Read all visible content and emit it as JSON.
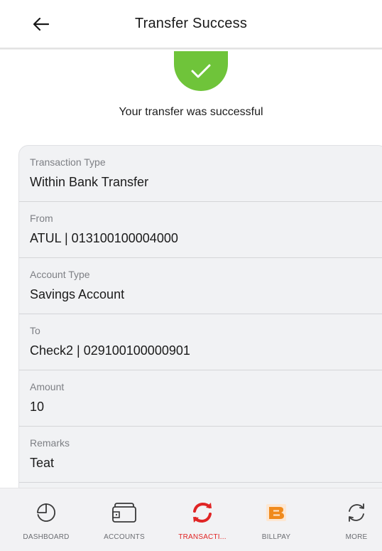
{
  "header": {
    "back_icon": "arrow-left-icon",
    "title": "Transfer Success"
  },
  "status": {
    "icon": "check-circle-icon",
    "color": "#6fc43a",
    "message": "Your transfer was successful"
  },
  "details": [
    {
      "label": "Transaction Type",
      "value": "Within Bank Transfer"
    },
    {
      "label": "From",
      "value": "ATUL | 013100100004000"
    },
    {
      "label": "Account Type",
      "value": "Savings Account"
    },
    {
      "label": "To",
      "value": "Check2 | 029100100000901"
    },
    {
      "label": "Amount",
      "value": "10"
    },
    {
      "label": "Remarks",
      "value": "Teat"
    }
  ],
  "bottom_nav": {
    "active_color": "#e02424",
    "items": [
      {
        "label": "DASHBOARD",
        "icon": "dashboard-icon"
      },
      {
        "label": "ACCOUNTS",
        "icon": "wallet-icon"
      },
      {
        "label": "TRANSACTI...",
        "icon": "transactions-icon",
        "active": true
      },
      {
        "label": "BILLPAY",
        "icon": "billpay-icon"
      },
      {
        "label": "MORE",
        "icon": "more-icon"
      }
    ]
  }
}
